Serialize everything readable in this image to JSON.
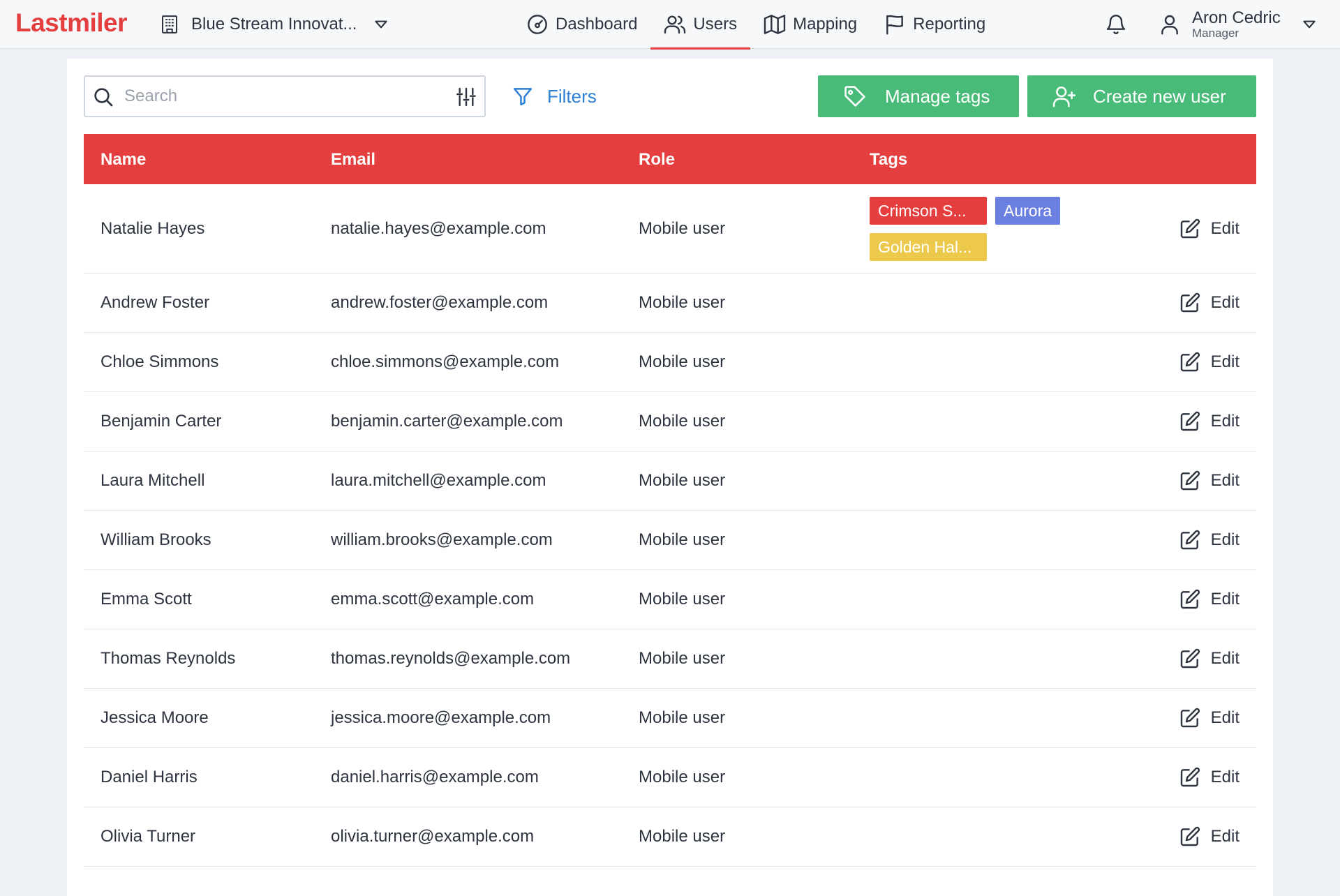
{
  "app": {
    "logo": "Lastmiler"
  },
  "org": {
    "name": "Blue Stream Innovat..."
  },
  "nav": {
    "items": [
      {
        "label": "Dashboard",
        "icon": "gauge-icon",
        "active": false
      },
      {
        "label": "Users",
        "icon": "users-icon",
        "active": true
      },
      {
        "label": "Mapping",
        "icon": "map-icon",
        "active": false
      },
      {
        "label": "Reporting",
        "icon": "flag-icon",
        "active": false
      }
    ]
  },
  "user": {
    "name": "Aron Cedric",
    "role": "Manager"
  },
  "toolbar": {
    "search_placeholder": "Search",
    "search_value": "",
    "filters_label": "Filters",
    "manage_tags_label": "Manage tags",
    "create_user_label": "Create new user"
  },
  "colors": {
    "brand": "#e53e3e",
    "green": "#48bb78",
    "link": "#2b7fd4",
    "tag_red": "#e53e3e",
    "tag_indigo": "#6b7fe0",
    "tag_yellow": "#ecc94b"
  },
  "table": {
    "headers": {
      "name": "Name",
      "email": "Email",
      "role": "Role",
      "tags": "Tags"
    },
    "edit_label": "Edit",
    "rows": [
      {
        "name": "Natalie Hayes",
        "email": "natalie.hayes@example.com",
        "role": "Mobile user",
        "tags": [
          {
            "label": "Crimson S...",
            "color": "#e53e3e"
          },
          {
            "label": "Aurora",
            "color": "#6b7fe0"
          },
          {
            "label": "Golden Hal...",
            "color": "#ecc94b"
          }
        ]
      },
      {
        "name": "Andrew Foster",
        "email": "andrew.foster@example.com",
        "role": "Mobile user",
        "tags": []
      },
      {
        "name": "Chloe Simmons",
        "email": "chloe.simmons@example.com",
        "role": "Mobile user",
        "tags": []
      },
      {
        "name": "Benjamin Carter",
        "email": "benjamin.carter@example.com",
        "role": "Mobile user",
        "tags": []
      },
      {
        "name": "Laura Mitchell",
        "email": "laura.mitchell@example.com",
        "role": "Mobile user",
        "tags": []
      },
      {
        "name": "William Brooks",
        "email": "william.brooks@example.com",
        "role": "Mobile user",
        "tags": []
      },
      {
        "name": "Emma Scott",
        "email": "emma.scott@example.com",
        "role": "Mobile user",
        "tags": []
      },
      {
        "name": "Thomas Reynolds",
        "email": "thomas.reynolds@example.com",
        "role": "Mobile user",
        "tags": []
      },
      {
        "name": "Jessica Moore",
        "email": "jessica.moore@example.com",
        "role": "Mobile user",
        "tags": []
      },
      {
        "name": "Daniel Harris",
        "email": "daniel.harris@example.com",
        "role": "Mobile user",
        "tags": []
      },
      {
        "name": "Olivia Turner",
        "email": "olivia.turner@example.com",
        "role": "Mobile user",
        "tags": []
      }
    ]
  }
}
